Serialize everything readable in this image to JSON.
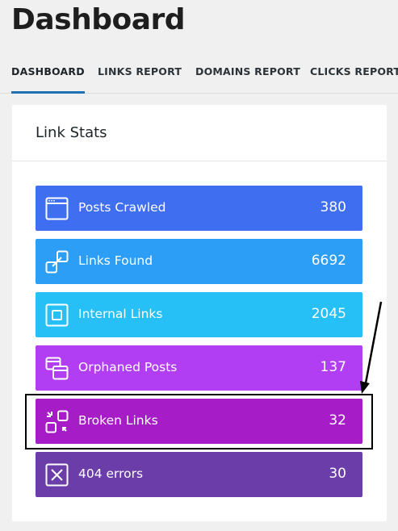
{
  "page": {
    "title": "Dashboard"
  },
  "tabs": [
    {
      "label": "DASHBOARD",
      "active": true
    },
    {
      "label": "LINKS REPORT",
      "active": false
    },
    {
      "label": "DOMAINS REPORT",
      "active": false
    },
    {
      "label": "CLICKS REPORT",
      "active": false
    }
  ],
  "card": {
    "title": "Link Stats",
    "stats": [
      {
        "label": "Posts Crawled",
        "value": "380",
        "color": "#3f6ff0",
        "icon": "browser-window-icon"
      },
      {
        "label": "Links Found",
        "value": "6692",
        "color": "#2d9ef5",
        "icon": "link-icon"
      },
      {
        "label": "Internal Links",
        "value": "2045",
        "color": "#26c0f7",
        "icon": "internal-link-icon"
      },
      {
        "label": "Orphaned Posts",
        "value": "137",
        "color": "#b13ef2",
        "icon": "stacked-windows-icon"
      },
      {
        "label": "Broken Links",
        "value": "32",
        "color": "#a61cc6",
        "icon": "broken-link-icon"
      },
      {
        "label": "404 errors",
        "value": "30",
        "color": "#6b3da8",
        "icon": "close-box-icon"
      }
    ]
  }
}
